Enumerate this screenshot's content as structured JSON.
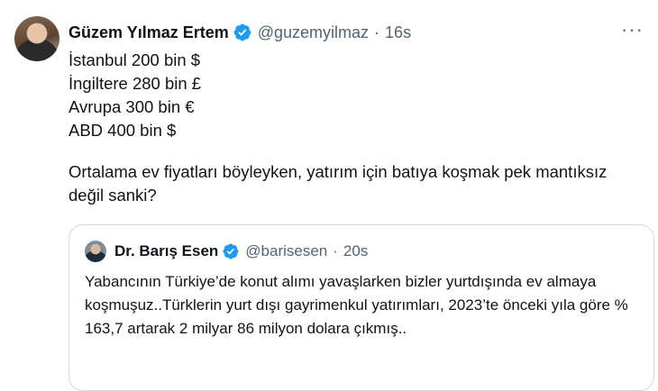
{
  "tweet": {
    "author_name": "Güzem Yılmaz Ertem",
    "handle": "@guzemyilmaz",
    "separator": "·",
    "time": "16s",
    "more_label": "···",
    "lines": [
      "İstanbul 200 bin $",
      "İngiltere 280 bin £",
      "Avrupa 300 bin €",
      "ABD 400 bin $"
    ],
    "paragraph": "Ortalama ev fiyatları böyleyken, yatırım için batıya koşmak pek mantıksız değil sanki?"
  },
  "quoted_tweet": {
    "author_name": "Dr. Barış Esen",
    "handle": "@barisesen",
    "separator": "·",
    "time": "20s",
    "text": "Yabancının Türkiye’de konut alımı yavaşlarken bizler yurtdışında ev almaya koşmuşuz..Türklerin yurt dışı gayrimenkul yatırımları, 2023’te önceki yıla göre % 163,7 artarak 2 milyar 86 milyon dolara çıkmış.."
  },
  "colors": {
    "verified": "#1d9bf0",
    "secondary_text": "#536471",
    "border": "#cfd9de"
  }
}
